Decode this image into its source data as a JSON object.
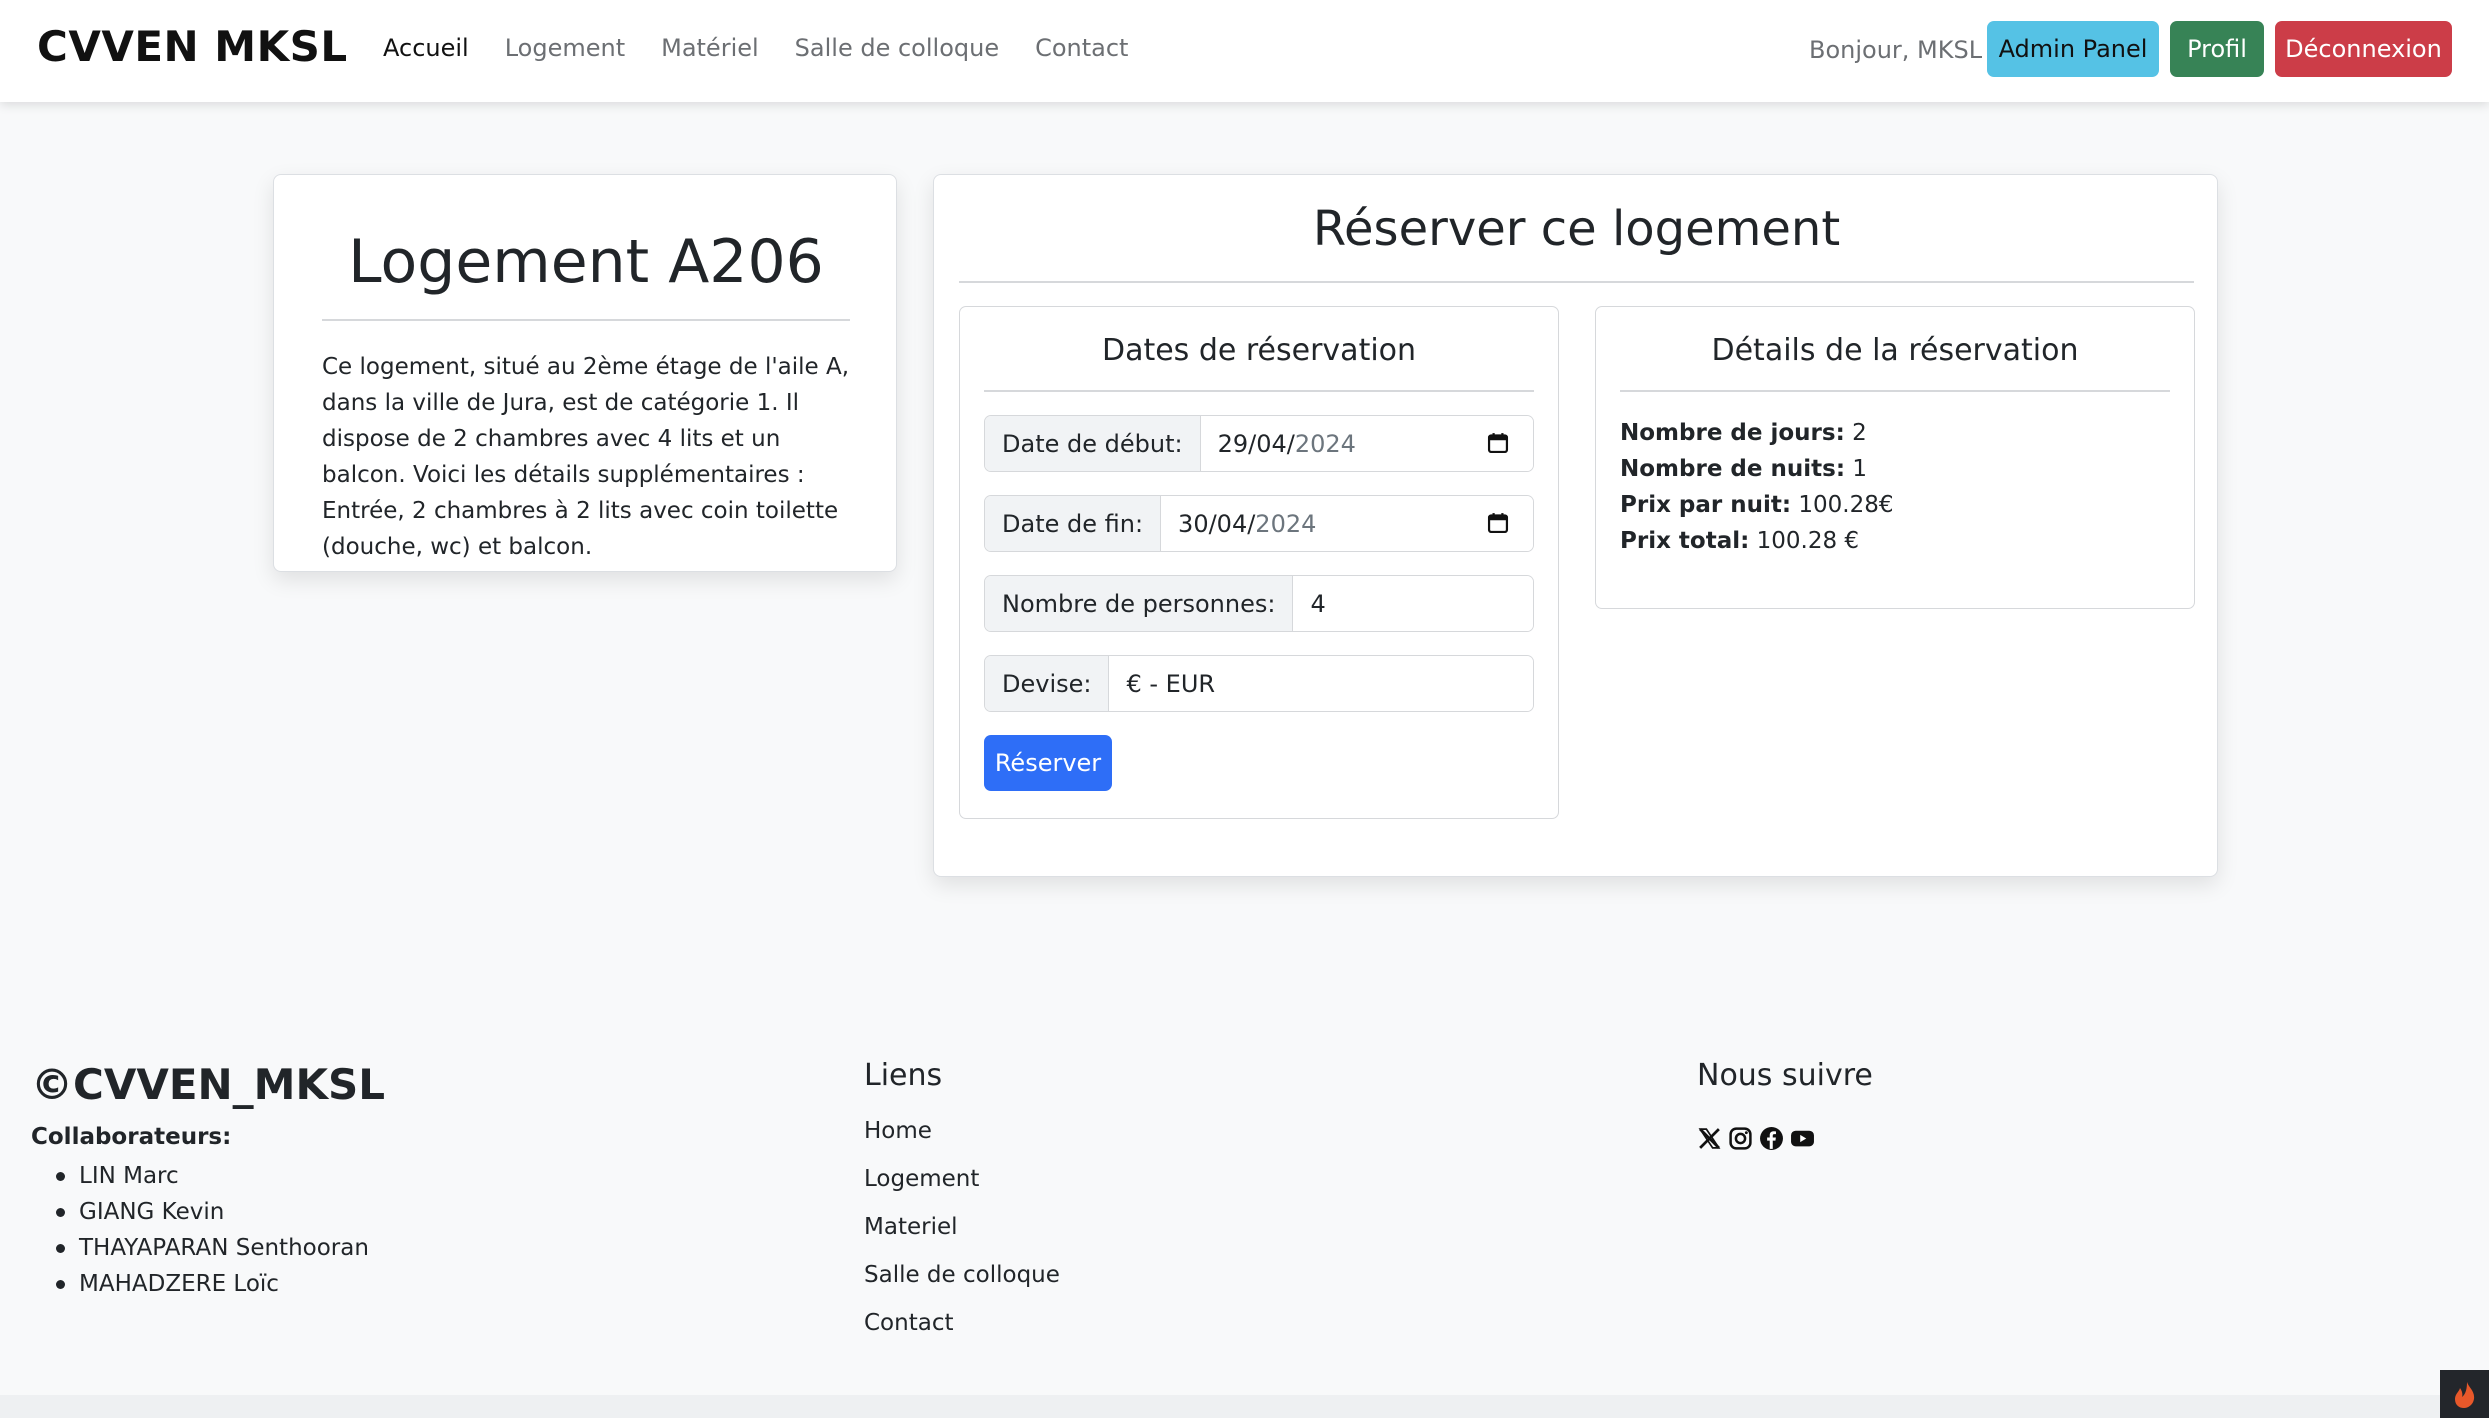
{
  "navbar": {
    "brand": "CVVEN MKSL",
    "links": [
      "Accueil",
      "Logement",
      "Matériel",
      "Salle de colloque",
      "Contact"
    ],
    "greeting": "Bonjour, MKSL",
    "admin_label": "Admin Panel",
    "profil_label": "Profil",
    "logout_label": "Déconnexion"
  },
  "logement": {
    "title": "Logement A206",
    "description": "Ce logement, situé au 2ème étage de l'aile A, dans la ville de Jura, est de catégorie 1. Il dispose de 2 chambres avec 4 lits et un balcon. Voici les détails supplémentaires : Entrée, 2 chambres à 2 lits avec coin toilette (douche, wc) et balcon."
  },
  "reservation": {
    "title": "Réserver ce logement",
    "dates": {
      "title": "Dates de réservation",
      "start_label": "Date de début:",
      "start_value_dm": "29/04/",
      "start_value_y": "2024",
      "end_label": "Date de fin:",
      "end_value_dm": "30/04/",
      "end_value_y": "2024",
      "persons_label": "Nombre de personnes:",
      "persons_value": "4",
      "currency_label": "Devise:",
      "currency_value": "€ - EUR",
      "submit_label": "Réserver"
    },
    "details": {
      "title": "Détails de la réservation",
      "days_label": "Nombre de jours:",
      "days_value": "2",
      "nights_label": "Nombre de nuits:",
      "nights_value": "1",
      "price_night_label": "Prix par nuit:",
      "price_night_value": "100.28€",
      "total_label": "Prix total:",
      "total_value": "100.28 €"
    }
  },
  "footer": {
    "brand": "©CVVEN_MKSL",
    "collab_label": "Collaborateurs:",
    "collaborators": [
      "LIN Marc",
      "GIANG Kevin",
      "THAYAPARAN Senthooran",
      "MAHADZERE Loïc"
    ],
    "links_title": "Liens",
    "links": [
      "Home",
      "Logement",
      "Materiel",
      "Salle de colloque",
      "Contact"
    ],
    "follow_title": "Nous suivre",
    "socials": [
      "x-icon",
      "instagram-icon",
      "facebook-icon",
      "youtube-icon"
    ]
  },
  "colors": {
    "admin": "#55c2e5",
    "profil": "#378356",
    "logout": "#cc3d48",
    "primary": "#2e6ef7"
  }
}
